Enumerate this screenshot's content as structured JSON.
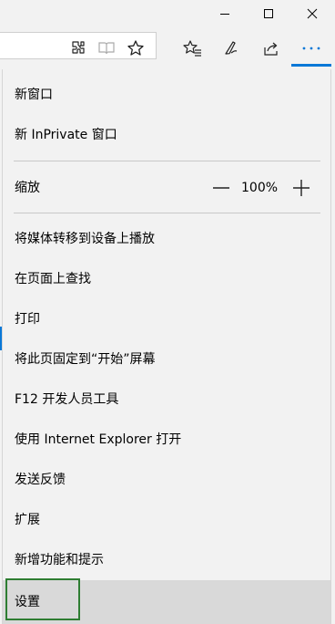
{
  "window": {
    "controls": [
      "minimize",
      "maximize",
      "close"
    ]
  },
  "toolbar": {
    "icons": [
      "extensions-icon",
      "reading-view-icon",
      "favorite-star-icon",
      "favorites-hub-icon",
      "pen-icon",
      "share-icon",
      "more-icon"
    ]
  },
  "menu": {
    "items": [
      {
        "label": "新窗口"
      },
      {
        "label": "新 InPrivate 窗口"
      },
      {
        "label": "将媒体转移到设备上播放"
      },
      {
        "label": "在页面上查找"
      },
      {
        "label": "打印"
      },
      {
        "label": "将此页固定到“开始”屏幕"
      },
      {
        "label": "F12 开发人员工具"
      },
      {
        "label": "使用 Internet Explorer 打开"
      },
      {
        "label": "发送反馈"
      },
      {
        "label": "扩展"
      },
      {
        "label": "新增功能和提示"
      },
      {
        "label": "设置"
      }
    ],
    "zoom": {
      "label": "缩放",
      "value": "100%"
    }
  },
  "colors": {
    "accent": "#0a78d7",
    "highlight_border": "#2e7d32",
    "menu_bg": "#f2f2f2",
    "selected_bg": "#d9d9d9"
  }
}
